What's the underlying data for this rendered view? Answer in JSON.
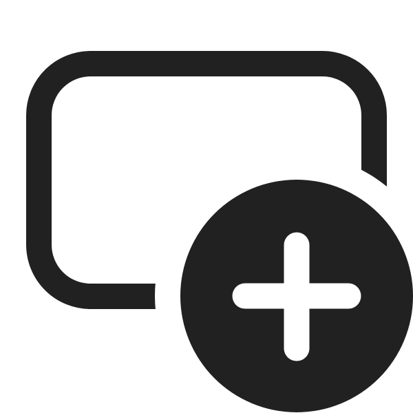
{
  "icon": {
    "name": "rectangle-add-icon",
    "parts": [
      "rectangle-outline",
      "plus-badge"
    ],
    "colors": {
      "glyph": "#212121",
      "background": "#ffffff",
      "plus": "#ffffff"
    }
  }
}
